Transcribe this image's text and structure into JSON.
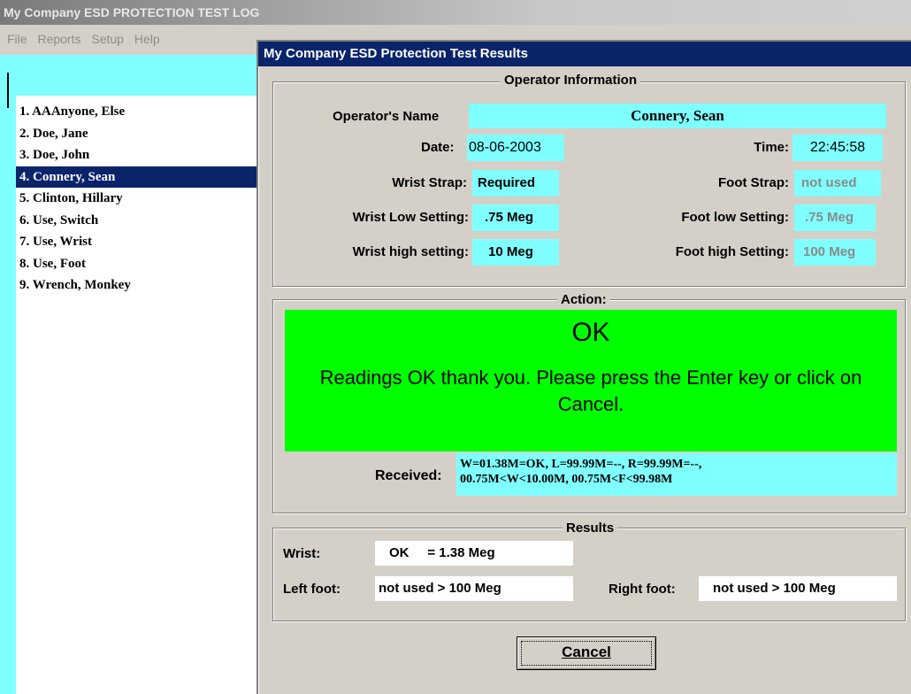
{
  "window": {
    "title": "My Company ESD PROTECTION TEST LOG"
  },
  "menu": [
    {
      "label": "File"
    },
    {
      "label": "Reports"
    },
    {
      "label": "Setup"
    },
    {
      "label": "Help"
    }
  ],
  "operators": [
    "1. AAAnyone, Else",
    "2. Doe, Jane",
    "3. Doe, John",
    "4. Connery, Sean",
    "5. Clinton, Hillary",
    "6. Use, Switch",
    "7. Use, Wrist",
    "8. Use, Foot",
    "9. Wrench, Monkey"
  ],
  "selected_operator_index": 3,
  "dialog": {
    "title": "My Company ESD Protection Test Results",
    "operator_info": {
      "legend": "Operator Information",
      "name_label": "Operator's Name",
      "name_value": "Connery, Sean",
      "date_label": "Date:",
      "date_value": "08-06-2003",
      "time_label": "Time:",
      "time_value": "22:45:58",
      "wrist_strap_label": "Wrist Strap:",
      "wrist_strap_value": "Required",
      "foot_strap_label": "Foot Strap:",
      "foot_strap_value": "not used",
      "wrist_low_label": "Wrist Low Setting:",
      "wrist_low_value": ".75 Meg",
      "foot_low_label": "Foot low Setting:",
      "foot_low_value": ".75 Meg",
      "wrist_high_label": "Wrist high setting:",
      "wrist_high_value": "10 Meg",
      "foot_high_label": "Foot high Setting:",
      "foot_high_value": "100 Meg"
    },
    "action": {
      "legend": "Action:",
      "status": "OK",
      "message": "Readings OK thank you.  Please press the Enter key or click on Cancel.",
      "received_label": "Received:",
      "received_line1": "W=01.38M=OK, L=99.99M=--, R=99.99M=--,",
      "received_line2": "00.75M<W<10.00M, 00.75M<F<99.98M"
    },
    "results": {
      "legend": "Results",
      "wrist_label": "Wrist:",
      "wrist_value": "OK     = 1.38 Meg",
      "left_foot_label": "Left foot:",
      "left_foot_value": "not used > 100 Meg",
      "right_foot_label": "Right foot:",
      "right_foot_value": "not used > 100 Meg"
    },
    "cancel_label": "Cancel"
  },
  "colors": {
    "window_bg": "#d4d0c8",
    "field_cyan": "#80ffff",
    "status_green": "#00ff00",
    "selection_navy": "#0a246a"
  }
}
